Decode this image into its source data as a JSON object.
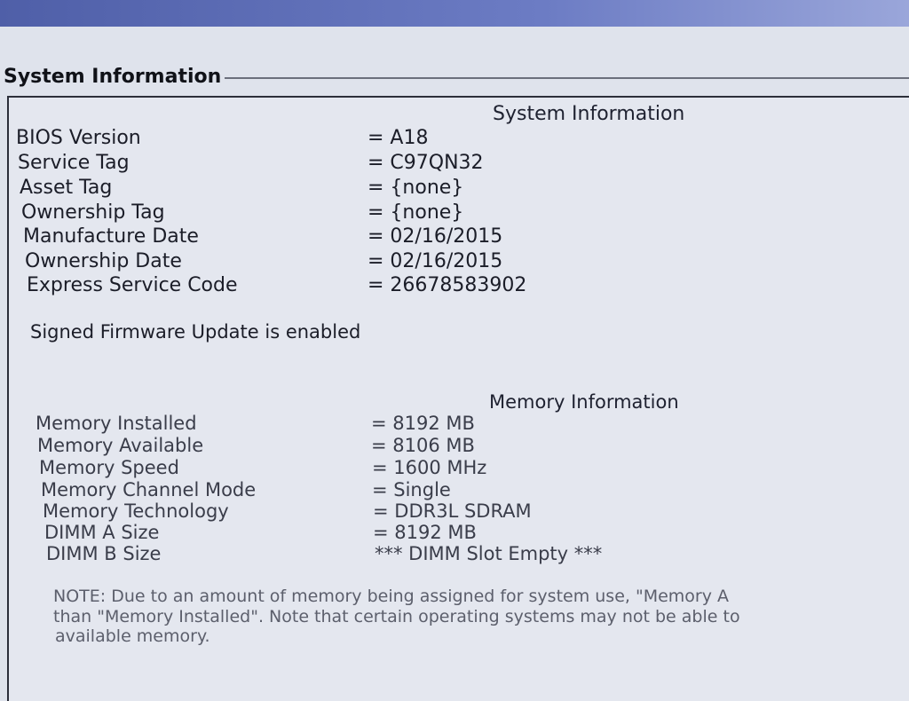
{
  "section_title": "System Information",
  "system": {
    "heading": "System Information",
    "rows": [
      {
        "label": "BIOS Version",
        "value": "= A18"
      },
      {
        "label": "Service Tag",
        "value": "= C97QN32"
      },
      {
        "label": "Asset Tag",
        "value": "= {none}"
      },
      {
        "label": "Ownership Tag",
        "value": "= {none}"
      },
      {
        "label": "Manufacture Date",
        "value": "= 02/16/2015"
      },
      {
        "label": "Ownership Date",
        "value": "= 02/16/2015"
      },
      {
        "label": "Express Service Code",
        "value": "= 26678583902"
      }
    ],
    "firmware_status": "Signed Firmware Update is enabled"
  },
  "memory": {
    "heading": "Memory Information",
    "rows": [
      {
        "label": "Memory Installed",
        "value": "= 8192 MB"
      },
      {
        "label": "Memory Available",
        "value": "= 8106 MB"
      },
      {
        "label": "Memory Speed",
        "value": "= 1600 MHz"
      },
      {
        "label": "Memory Channel Mode",
        "value": "= Single"
      },
      {
        "label": "Memory Technology",
        "value": "= DDR3L SDRAM"
      },
      {
        "label": "DIMM A Size",
        "value": "= 8192 MB"
      },
      {
        "label": "DIMM B Size",
        "value": "*** DIMM Slot Empty ***"
      }
    ],
    "note_lines": [
      "NOTE: Due to an amount of memory being assigned for system use, \"Memory A",
      "than \"Memory Installed\". Note that certain operating systems may not be able to",
      "available memory."
    ]
  }
}
